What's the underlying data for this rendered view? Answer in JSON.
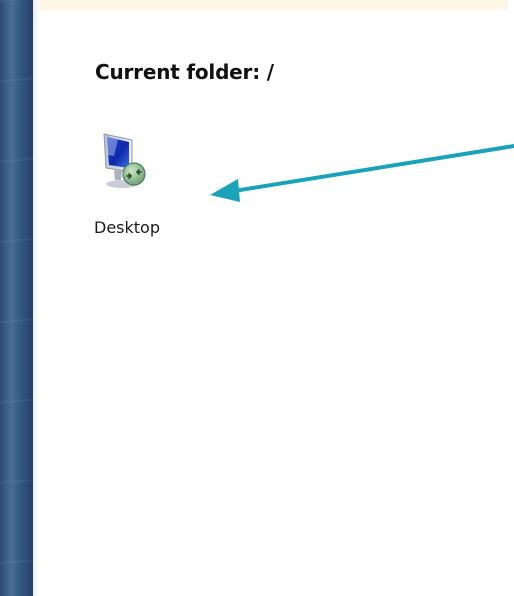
{
  "header": {
    "current_folder_label": "Current folder: /"
  },
  "files": [
    {
      "name": "Desktop",
      "icon": "remote-desktop-icon"
    }
  ],
  "colors": {
    "annotation_arrow": "#1aa3b8",
    "rail": "#33557f"
  }
}
